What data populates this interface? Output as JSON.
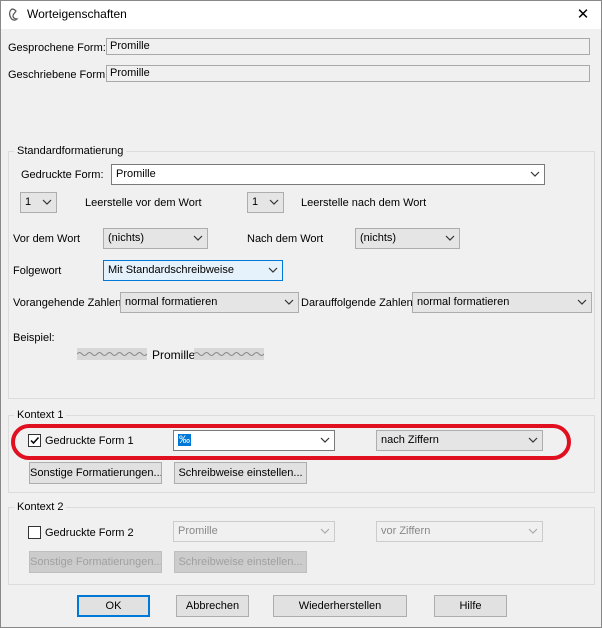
{
  "window": {
    "title": "Worteigenschaften",
    "close_label": "✕"
  },
  "spoken_form": {
    "label": "Gesprochene Form:",
    "value": "Promille"
  },
  "written_form": {
    "label": "Geschriebene Form:",
    "value": "Promille"
  },
  "standard": {
    "group_title": "Standardformatierung",
    "printed_form_label": "Gedruckte Form:",
    "printed_form_value": "Promille",
    "space_before_value": "1",
    "space_before_label": "Leerstelle vor dem Wort",
    "space_after_value": "1",
    "space_after_label": "Leerstelle nach dem Wort",
    "before_word_label": "Vor dem Wort",
    "before_word_value": "(nichts)",
    "after_word_label": "Nach dem Wort",
    "after_word_value": "(nichts)",
    "followword_label": "Folgewort",
    "followword_value": "Mit Standardschreibweise",
    "preceding_numbers_label": "Vorangehende Zahlen",
    "preceding_numbers_value": "normal formatieren",
    "following_numbers_label": "Darauffolgende Zahlen",
    "following_numbers_value": "normal formatieren",
    "example_label": "Beispiel:",
    "example_word": "Promille"
  },
  "context1": {
    "group_title": "Kontext 1",
    "checkbox_label": "Gedruckte Form 1",
    "checked": true,
    "form_value": "‰",
    "position_value": "nach Ziffern",
    "other_format_button": "Sonstige Formatierungen...",
    "spelling_button": "Schreibweise einstellen..."
  },
  "context2": {
    "group_title": "Kontext 2",
    "checkbox_label": "Gedruckte Form 2",
    "checked": false,
    "form_value": "Promille",
    "position_value": "vor Ziffern",
    "other_format_button": "Sonstige Formatierungen...",
    "spelling_button": "Schreibweise einstellen..."
  },
  "buttons": {
    "ok": "OK",
    "cancel": "Abbrechen",
    "restore": "Wiederherstellen",
    "help": "Hilfe"
  },
  "colors": {
    "dialog_bg": "#f0f0f0",
    "accent": "#0078d7",
    "highlight": "#e01020"
  }
}
